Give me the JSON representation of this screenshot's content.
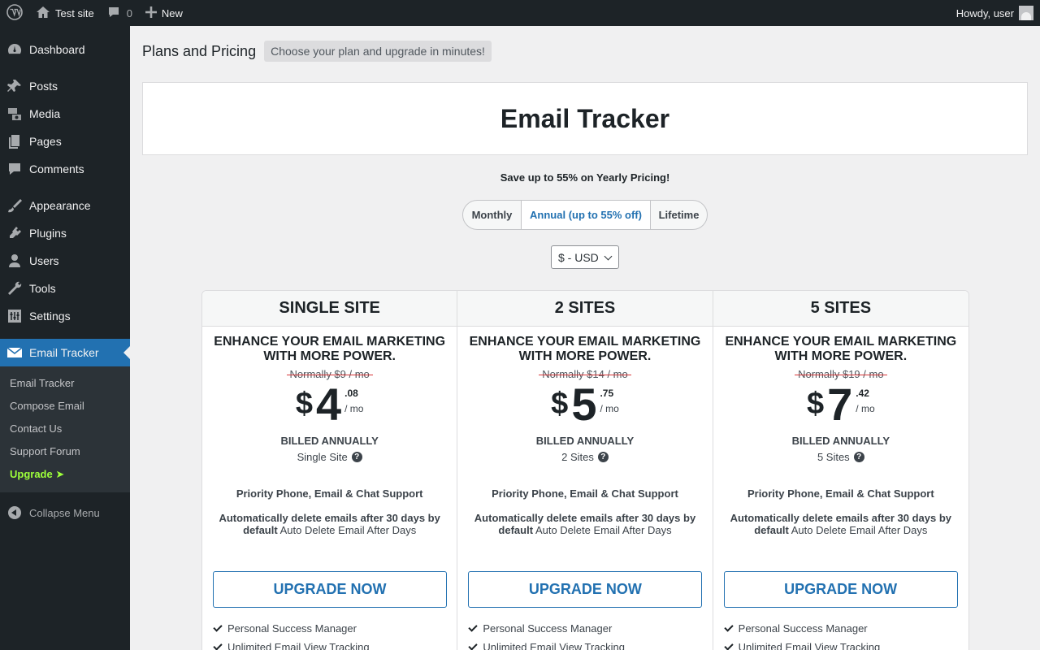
{
  "adminbar": {
    "wp_logo": "wordpress-icon",
    "site_name": "Test site",
    "comments_count": "0",
    "new_label": "New",
    "greeting": "Howdy, user"
  },
  "sidebar": {
    "items": [
      {
        "label": "Dashboard",
        "icon": "dashboard-icon"
      },
      {
        "label": "Posts",
        "icon": "pin-icon"
      },
      {
        "label": "Media",
        "icon": "media-icon"
      },
      {
        "label": "Pages",
        "icon": "pages-icon"
      },
      {
        "label": "Comments",
        "icon": "comment-icon"
      },
      {
        "label": "Appearance",
        "icon": "brush-icon"
      },
      {
        "label": "Plugins",
        "icon": "plug-icon"
      },
      {
        "label": "Users",
        "icon": "user-icon"
      },
      {
        "label": "Tools",
        "icon": "wrench-icon"
      },
      {
        "label": "Settings",
        "icon": "settings-icon"
      },
      {
        "label": "Email Tracker",
        "icon": "envelope-icon"
      }
    ],
    "submenu": [
      "Email Tracker",
      "Compose Email",
      "Contact Us",
      "Support Forum",
      "Upgrade ➤"
    ],
    "collapse": "Collapse Menu"
  },
  "header": {
    "title": "Plans and Pricing",
    "tagline": "Choose your plan and upgrade in minutes!"
  },
  "product": "Email Tracker",
  "save_text": "Save up to 55% on Yearly Pricing!",
  "billing_options": [
    "Monthly",
    "Annual (up to 55% off)",
    "Lifetime"
  ],
  "selected_billing": "Annual (up to 55% off)",
  "currency": "$ - USD",
  "plans": [
    {
      "name": "SINGLE SITE",
      "description": "ENHANCE YOUR EMAIL MARKETING WITH MORE POWER.",
      "normally": "Normally $9 / mo",
      "currency_symbol": "$",
      "price_int": "4",
      "price_cents": ".08",
      "per": "/ mo",
      "billed": "BILLED ANNUALLY",
      "sites": "Single Site",
      "support": "Priority Phone, Email & Chat Support",
      "autodelete_bold": "Automatically delete emails after 30 days by default",
      "autodelete_rest": "Auto Delete Email After Days",
      "button": "UPGRADE NOW",
      "features": [
        "Personal Success Manager",
        "Unlimited Email View Tracking"
      ]
    },
    {
      "name": "2 SITES",
      "description": "ENHANCE YOUR EMAIL MARKETING WITH MORE POWER.",
      "normally": "Normally $14 / mo",
      "currency_symbol": "$",
      "price_int": "5",
      "price_cents": ".75",
      "per": "/ mo",
      "billed": "BILLED ANNUALLY",
      "sites": "2 Sites",
      "support": "Priority Phone, Email & Chat Support",
      "autodelete_bold": "Automatically delete emails after 30 days by default",
      "autodelete_rest": "Auto Delete Email After Days",
      "button": "UPGRADE NOW",
      "features": [
        "Personal Success Manager",
        "Unlimited Email View Tracking"
      ]
    },
    {
      "name": "5 SITES",
      "description": "ENHANCE YOUR EMAIL MARKETING WITH MORE POWER.",
      "normally": "Normally $19 / mo",
      "currency_symbol": "$",
      "price_int": "7",
      "price_cents": ".42",
      "per": "/ mo",
      "billed": "BILLED ANNUALLY",
      "sites": "5 Sites",
      "support": "Priority Phone, Email & Chat Support",
      "autodelete_bold": "Automatically delete emails after 30 days by default",
      "autodelete_rest": "Auto Delete Email After Days",
      "button": "UPGRADE NOW",
      "features": [
        "Personal Success Manager",
        "Unlimited Email View Tracking"
      ]
    }
  ],
  "colors": {
    "admin_bg": "#1d2327",
    "accent": "#2271b1",
    "upgrade_green": "#9dff3a",
    "page_bg": "#f0f0f1"
  }
}
